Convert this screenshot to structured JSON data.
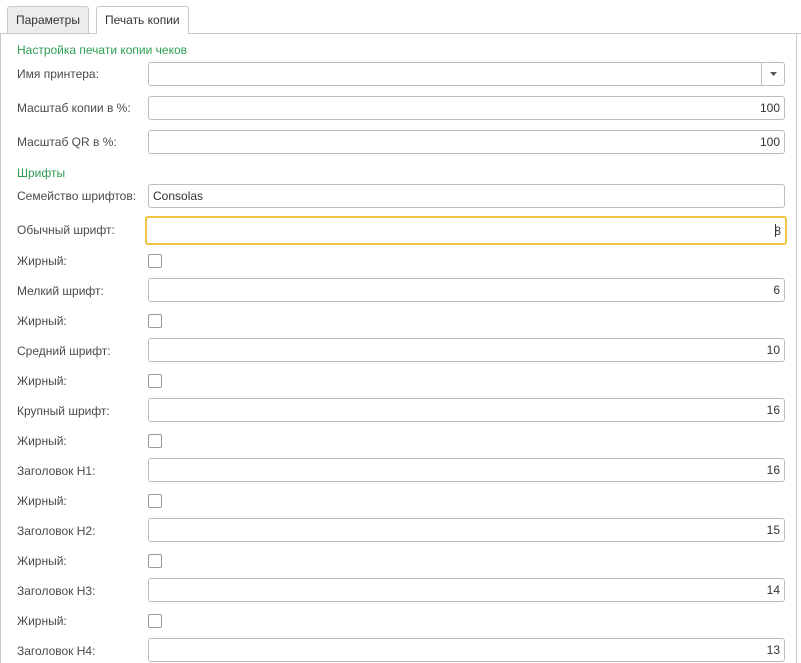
{
  "tabs": [
    "Параметры",
    "Печать копии"
  ],
  "sections": {
    "print_settings": "Настройка печати копии чеков",
    "fonts": "Шрифты"
  },
  "fields": {
    "printer_name": {
      "label": "Имя принтера:",
      "value": ""
    },
    "copy_scale": {
      "label": "Масштаб копии в %:",
      "value": "100"
    },
    "qr_scale": {
      "label": "Масштаб QR в %:",
      "value": "100"
    },
    "font_family": {
      "label": "Семейство шрифтов:",
      "value": "Consolas"
    },
    "normal_font": {
      "label": "Обычный шрифт:",
      "value": "8"
    },
    "normal_bold": {
      "label": "Жирный:",
      "checked": false
    },
    "small_font": {
      "label": "Мелкий шрифт:",
      "value": "6"
    },
    "small_bold": {
      "label": "Жирный:",
      "checked": false
    },
    "medium_font": {
      "label": "Средний шрифт:",
      "value": "10"
    },
    "medium_bold": {
      "label": "Жирный:",
      "checked": false
    },
    "large_font": {
      "label": "Крупный шрифт:",
      "value": "16"
    },
    "large_bold": {
      "label": "Жирный:",
      "checked": false
    },
    "h1": {
      "label": "Заголовок H1:",
      "value": "16"
    },
    "h1_bold": {
      "label": "Жирный:",
      "checked": false
    },
    "h2": {
      "label": "Заголовок H2:",
      "value": "15"
    },
    "h2_bold": {
      "label": "Жирный:",
      "checked": false
    },
    "h3": {
      "label": "Заголовок H3:",
      "value": "14"
    },
    "h3_bold": {
      "label": "Жирный:",
      "checked": false
    },
    "h4": {
      "label": "Заголовок H4:",
      "value": "13"
    }
  },
  "colors": {
    "section": "#2f9d52",
    "focus": "#f0c43f"
  },
  "icons": {
    "dropdown": "chevron-down-icon"
  }
}
